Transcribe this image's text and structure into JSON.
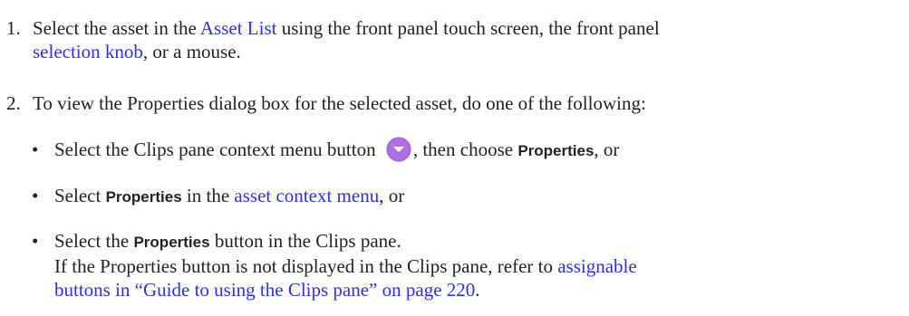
{
  "colors": {
    "text": "#222222",
    "link": "#2f2fe0",
    "icon_fill": "#b070e0"
  },
  "step1": {
    "number": "1.",
    "text_before": "Select the asset in the ",
    "link_asset_list": "Asset List",
    "text_middle": " using the front panel touch screen, the front panel",
    "link_selection_knob": "selection knob",
    "text_after": ", or a mouse."
  },
  "step2": {
    "number": "2.",
    "text": "To view the Properties dialog box for the selected asset, do one of the following:"
  },
  "bullets": [
    {
      "dot": "•",
      "text_before": "Select the Clips pane context menu button ",
      "icon": "context-menu-chevron-icon",
      "text_middle": ", then choose ",
      "ui_label": "Properties",
      "text_after": ", or"
    },
    {
      "dot": "•",
      "text_before": "Select ",
      "ui_label": "Properties",
      "text_middle": " in the ",
      "link": "asset context menu",
      "text_after": ", or"
    },
    {
      "dot": "•",
      "text_before": "Select the ",
      "ui_label": "Properties",
      "text_after": " button in the Clips pane.",
      "line2_text": "If the Properties button is not displayed in the Clips pane, refer to ",
      "link_line2": "assignable",
      "link_line3": "buttons in “Guide to using the Clips pane” on page 220",
      "line3_after": "."
    }
  ]
}
